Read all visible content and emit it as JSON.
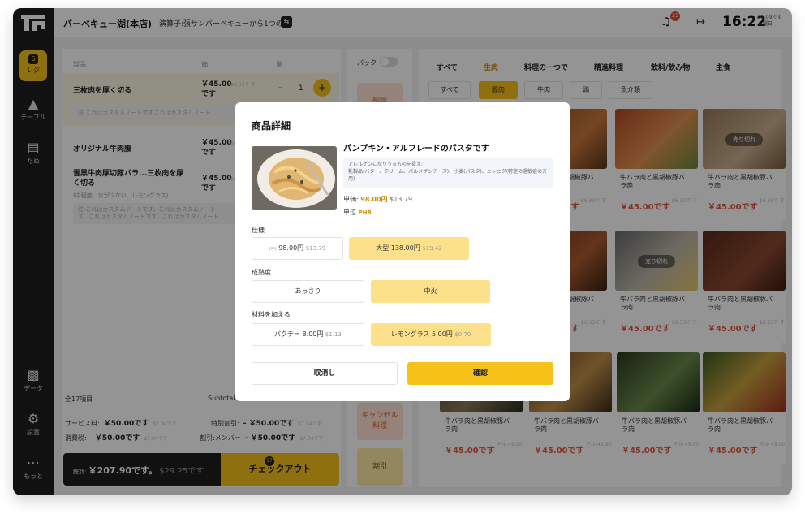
{
  "header": {
    "store_name": "バーベキュー湖(本店)",
    "promo": "演算子:張サンバーベキューから1つの",
    "notif_count": "25",
    "time": "16:22",
    "date": "01-09です",
    "weekday": "火曜日"
  },
  "rail": {
    "active": {
      "badge": "6",
      "label": "レジ"
    },
    "items": [
      "テーブル",
      "ため",
      "データ",
      "設置",
      "もっと"
    ]
  },
  "order": {
    "col1": "製品",
    "col2": "価",
    "col3": "量",
    "rows": [
      {
        "name": "三枚肉を厚く切る",
        "price_1": "￥45.00",
        "price_2": "です",
        "old": "$6.33で す",
        "qty": "1",
        "note": "注:これはカスタムノートですこれはカスタムノート"
      },
      {
        "name": "オリジナル牛肉腹",
        "price_1": "￥45.00",
        "price_2": "です",
        "old": "$6.33で す"
      },
      {
        "name_1": "雪黒牛肉厚切豚バラ...三枚肉を厚",
        "name_2": "く切る",
        "sub": "(中程度、氷が少ない、レモングラス)",
        "price_1": "￥45.00",
        "price_2": "です",
        "old": "$6.33で す",
        "note_1": "注:これはカスタムノートです。これはカスタムノート",
        "note_2": "す。これはカスタムノートです。これはカスタムノート"
      }
    ],
    "count": "全17項目",
    "subtotal_label": "Subtotal",
    "service_label": "サービス料:",
    "service_value": "￥50.00です",
    "service_usd": "$7.04です",
    "special_label": "特別割引:",
    "special_value": "- ￥50.00です",
    "special_usd": "$7.04です",
    "tax_label": "消費税:",
    "tax_value": "￥50.00です",
    "tax_usd": "$7.04です",
    "member_label": "割引:メンバー",
    "member_value": "- ￥50.00です",
    "member_usd": "$7.04です",
    "total_label": "総計:",
    "total_value": "￥207.90です。",
    "total_usd": "$29.25です",
    "checkout": "チェックアウト",
    "checkout_count": "17"
  },
  "actions": {
    "pack": "パック",
    "delete": "削除",
    "cancel_order_1": "キャンセル",
    "cancel_order_2": "料理",
    "discount": "割引"
  },
  "menu": {
    "categories": [
      "すべて",
      "生肉",
      "料理の一つで",
      "精進料理",
      "飲料/飲み物",
      "主食"
    ],
    "chips": [
      "すべて",
      "豚肉",
      "牛肉",
      "鶏",
      "魚介類"
    ],
    "item_name_1": "牛バラ肉と黒胡椒豚バ",
    "item_name_2": "ラ肉",
    "item_price": "￥45.00です",
    "item_old": "$6.33で す",
    "item_old_alt": "ドル 45.00",
    "sold_out": "売り切れ"
  },
  "modal": {
    "title": "商品詳細",
    "product_name": "パンプキン・アルフレードのパスタです",
    "allergen_title": "アレルゲンになりうるものを捉え:",
    "allergen_body": "乳製品(バター、クリーム、パルメザンチーズ)、小麦(パスタ)、ニンニク(特定の過敏症の方用)",
    "price_label": "単価:",
    "price_value": "98.00円",
    "price_usd": "$13.79",
    "unit_label": "単位",
    "unit_value": "PHR",
    "spec_label": "仕様",
    "spec_options": [
      {
        "tag": "(中)",
        "label": "98.00円",
        "usd": "$13.79"
      },
      {
        "label": "大型 138.00円",
        "usd": "$19.42"
      }
    ],
    "doneness_label": "成熟度",
    "doneness_options": [
      "あっさり",
      "中火"
    ],
    "add_label": "材料を加える",
    "add_options": [
      {
        "label": "パクチー 8.00円",
        "usd": "$1.13"
      },
      {
        "label": "レモングラス 5.00円",
        "usd": "$0.70"
      }
    ],
    "cancel": "取消し",
    "confirm": "確認"
  }
}
